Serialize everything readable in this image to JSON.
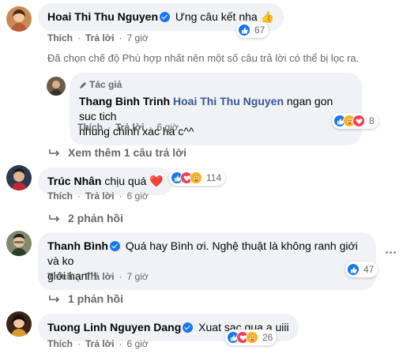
{
  "comments": [
    {
      "author": "Hoai Thi Thu Nguyen",
      "text": "Ưng câu kết nha",
      "emoji": "👍",
      "like_label": "Thích",
      "reply_label": "Trả lời",
      "time": "7 giờ",
      "reaction_count": "67",
      "reactions": [
        "like-icon"
      ]
    },
    {
      "author": "Trúc Nhân",
      "text": "chịu quá",
      "emoji": "❤️",
      "like_label": "Thích",
      "reply_label": "Trả lời",
      "time": "6 giờ",
      "reaction_count": "114",
      "reactions": [
        "like-icon",
        "love-icon",
        "care-icon"
      ],
      "replies_link": "2 phản hồi"
    },
    {
      "author": "Thanh Bình",
      "text_line1": "Quá hay Bình ơi. Nghệ thuật là không ranh giới và ko",
      "text_line2": "giới hạn!!!",
      "like_label": "Thích",
      "reply_label": "Trả lời",
      "time": "7 giờ",
      "reaction_count": "47",
      "reactions": [
        "like-icon"
      ],
      "replies_link": "1 phản hồi"
    },
    {
      "author": "Tuong Linh Nguyen Dang",
      "text": "Xuat sac qua a uiii",
      "like_label": "Thích",
      "reply_label": "Trả lời",
      "time": "6 giờ",
      "reaction_count": "26",
      "reactions": [
        "like-icon",
        "love-icon",
        "care-icon"
      ]
    }
  ],
  "filter_note": "Đã chọn chế độ Phù hợp nhất nên một số câu trả lời có thể bị lọc ra.",
  "reply": {
    "badge": "Tác giả",
    "author": "Thang Binh Trinh",
    "mention": "Hoai Thi Thu Nguyen",
    "text_line1": "ngan gon suc tich",
    "text_line2": "nhung chinh xac ha c^^",
    "like_label": "Thích",
    "reply_label": "Trả lời",
    "time": "6 giờ",
    "reaction_count": "8",
    "reactions": [
      "like-icon",
      "care-icon",
      "love-icon"
    ]
  },
  "view_more_replies": "Xem thêm 1 câu trả lời",
  "colors": {
    "bubble": "#f0f2f5",
    "secondary_text": "#65676b",
    "like_blue": "#1877f2",
    "love_red": "#f33e58",
    "care_yellow": "#f7b125"
  }
}
